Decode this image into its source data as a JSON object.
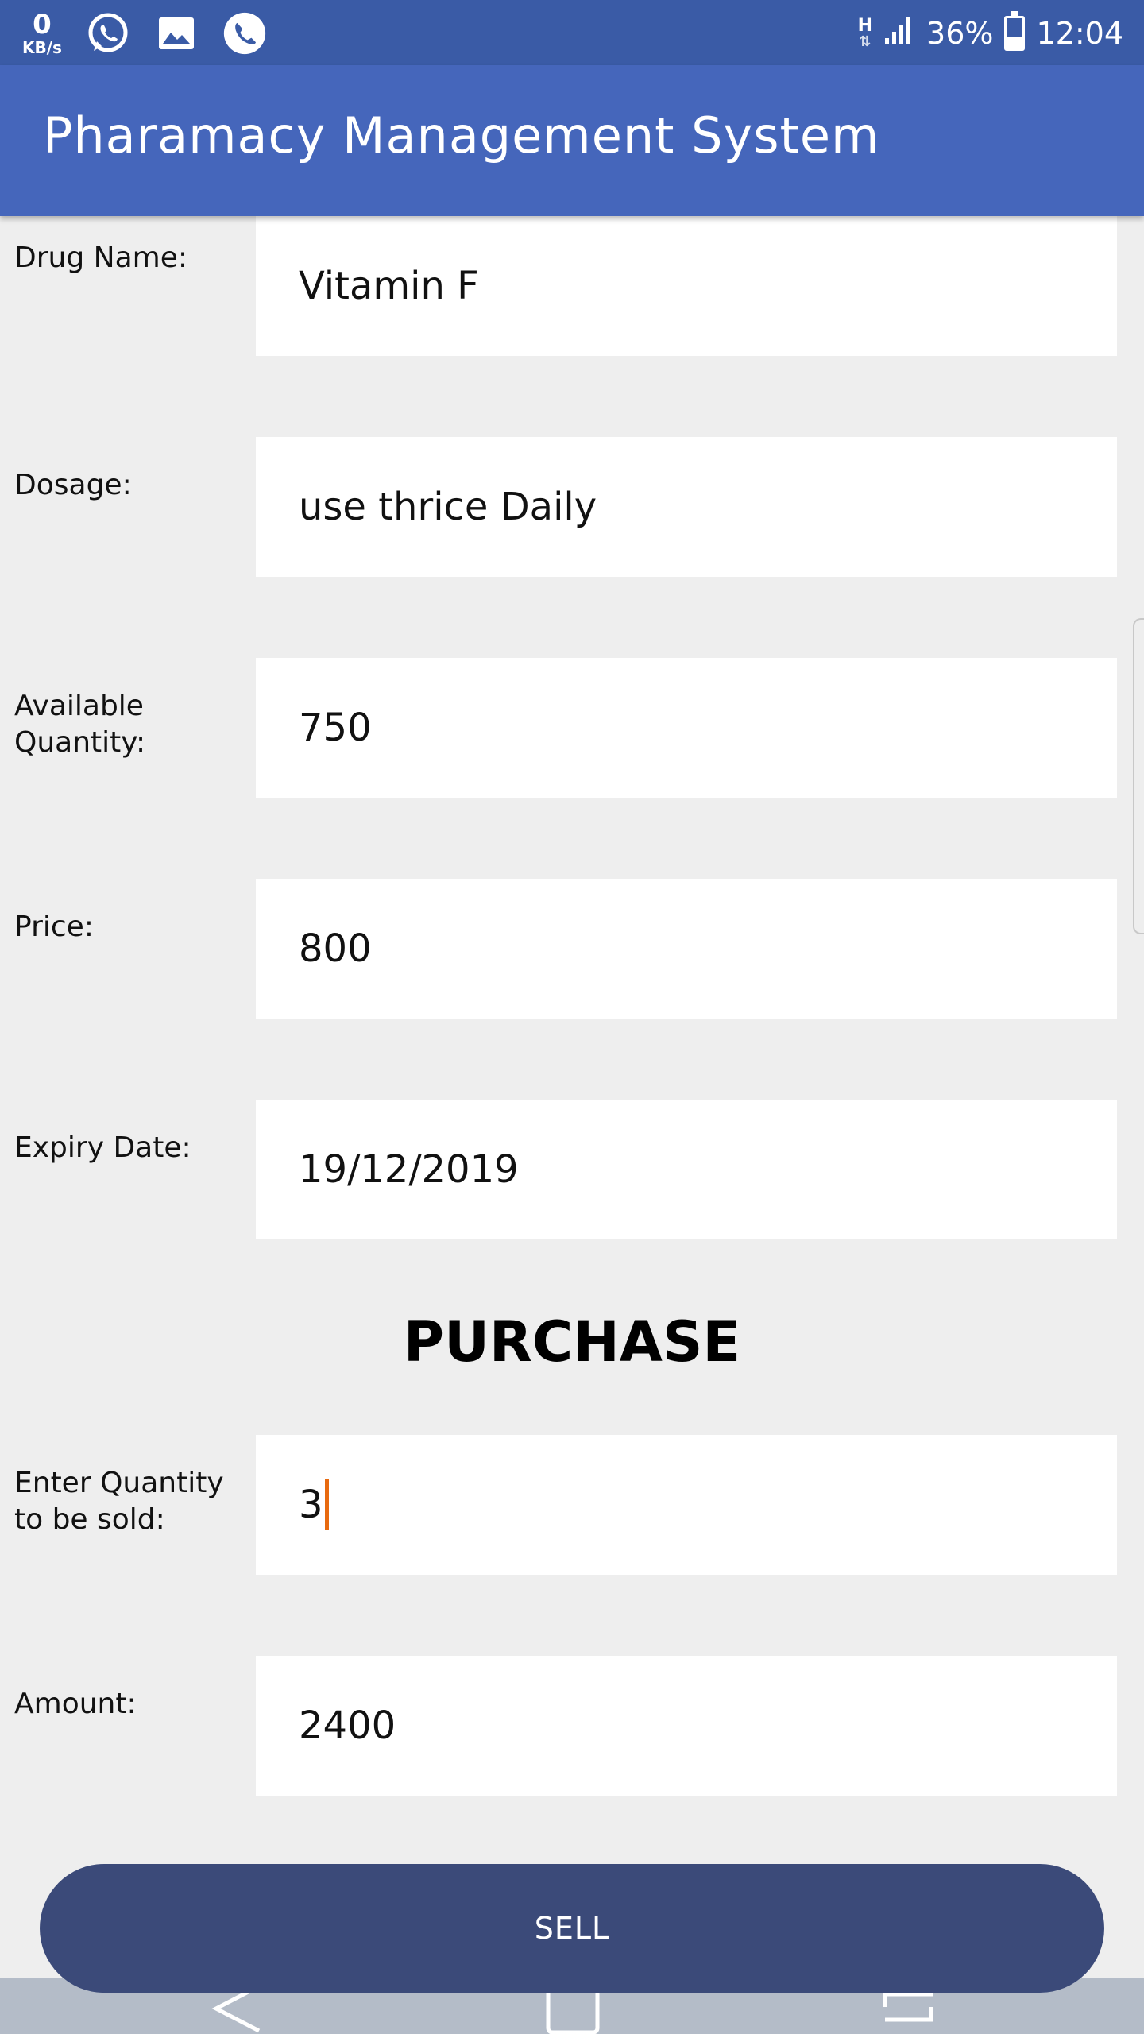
{
  "status_bar": {
    "net_speed_value": "0",
    "net_speed_unit": "KB/s",
    "network_type": "H",
    "network_arrows": "⇅",
    "battery_percent": "36%",
    "battery_level": 0.36,
    "time": "12:04",
    "icons": [
      "whatsapp-icon",
      "image-icon",
      "phone-icon",
      "signal-icon",
      "battery-icon"
    ]
  },
  "app_bar": {
    "title": "Pharamacy Management System"
  },
  "form": {
    "drug_name": {
      "label": "Drug Name:",
      "value": "Vitamin F"
    },
    "dosage": {
      "label": "Dosage:",
      "value": "use thrice Daily"
    },
    "available_quantity": {
      "label": "Available Quantity:",
      "value": "750"
    },
    "price": {
      "label": "Price:",
      "value": "800"
    },
    "expiry_date": {
      "label": "Expiry Date:",
      "value": "19/12/2019"
    }
  },
  "purchase": {
    "heading": "PURCHASE",
    "quantity": {
      "label": "Enter Quantity to be sold:",
      "value": "3"
    },
    "amount": {
      "label": "Amount:",
      "value": "2400"
    },
    "sell_label": "SELL"
  },
  "nav_bar": {
    "buttons": [
      "back-icon",
      "home-icon",
      "recents-icon"
    ]
  },
  "colors": {
    "status_bar": "#3a5ba6",
    "app_bar": "#4566bb",
    "sell_button": "#3b4a79",
    "background": "#eeeeee",
    "cursor": "#e86a10"
  }
}
